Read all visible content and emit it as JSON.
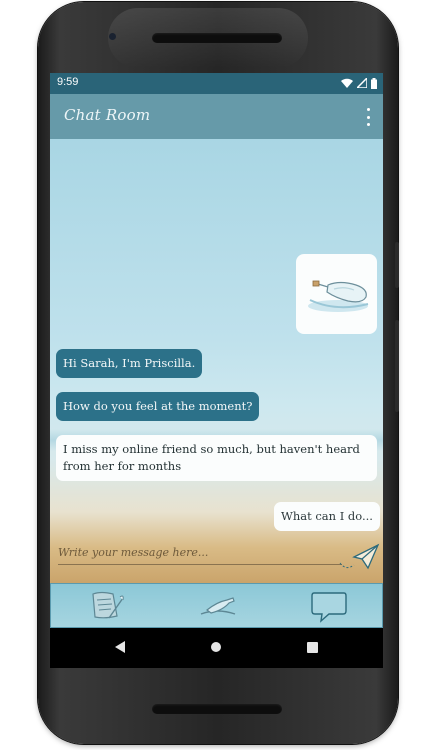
{
  "status": {
    "time": "9:59"
  },
  "appbar": {
    "title": "Chat Room"
  },
  "messages": [
    {
      "text": "Hi Sarah, I'm Priscilla."
    },
    {
      "text": "How do you feel at the moment?"
    },
    {
      "text": "I miss my online friend so much, but haven't heard from her for months"
    },
    {
      "text": "What can I do..."
    }
  ],
  "composer": {
    "placeholder": "Write your message here..."
  },
  "bottom_nav": {
    "icons": [
      "scroll-letter-icon",
      "message-bottle-icon",
      "speech-bubble-icon"
    ]
  },
  "colors": {
    "appbar": "#669aa9",
    "statusbar": "#2a6478",
    "bubble_in": "#2c7189",
    "bubble_out": "#fbfdfd"
  }
}
